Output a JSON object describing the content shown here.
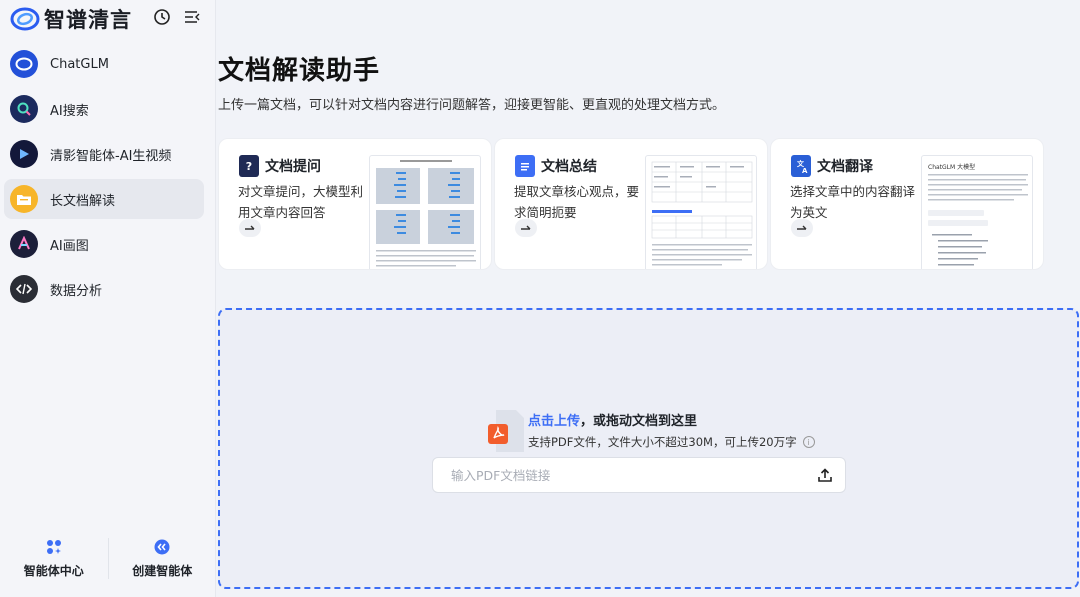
{
  "brand": {
    "name": "智谱清言",
    "accent": "#3d6ef5"
  },
  "top_icons": [
    "history-icon",
    "collapse-sidebar-icon"
  ],
  "sidebar": {
    "items": [
      {
        "label": "ChatGLM",
        "icon": "chatglm-icon",
        "active": false
      },
      {
        "label": "AI搜索",
        "icon": "ai-search-icon",
        "active": false
      },
      {
        "label": "清影智能体-AI生视频",
        "icon": "ai-video-icon",
        "active": false
      },
      {
        "label": "长文档解读",
        "icon": "folder-icon",
        "active": true
      },
      {
        "label": "AI画图",
        "icon": "ai-draw-icon",
        "active": false
      },
      {
        "label": "数据分析",
        "icon": "code-icon",
        "active": false
      }
    ],
    "bottom": [
      {
        "label": "智能体中心",
        "icon": "agents-grid-icon"
      },
      {
        "label": "创建智能体",
        "icon": "create-agent-icon"
      }
    ]
  },
  "main": {
    "title": "文档解读助手",
    "subtitle": "上传一篇文档，可以针对文档内容进行问题解答，迎接更智能、更直观的处理文档方式。",
    "cards": [
      {
        "title": "文档提问",
        "desc": "对文章提问，大模型利用文章内容回答",
        "icon": "doc-question-icon"
      },
      {
        "title": "文档总结",
        "desc": "提取文章核心观点，要求简明扼要",
        "icon": "doc-summary-icon"
      },
      {
        "title": "文档翻译",
        "desc": "选择文章中的内容翻译为英文",
        "icon": "doc-translate-icon",
        "preview_title": "ChatGLM 大模型"
      }
    ],
    "upload": {
      "link_text": "点击上传",
      "rest_text": "，或拖动文档到这里",
      "hint": "支持PDF文件，文件大小不超过30M，可上传20万字",
      "url_placeholder": "输入PDF文档链接"
    }
  }
}
